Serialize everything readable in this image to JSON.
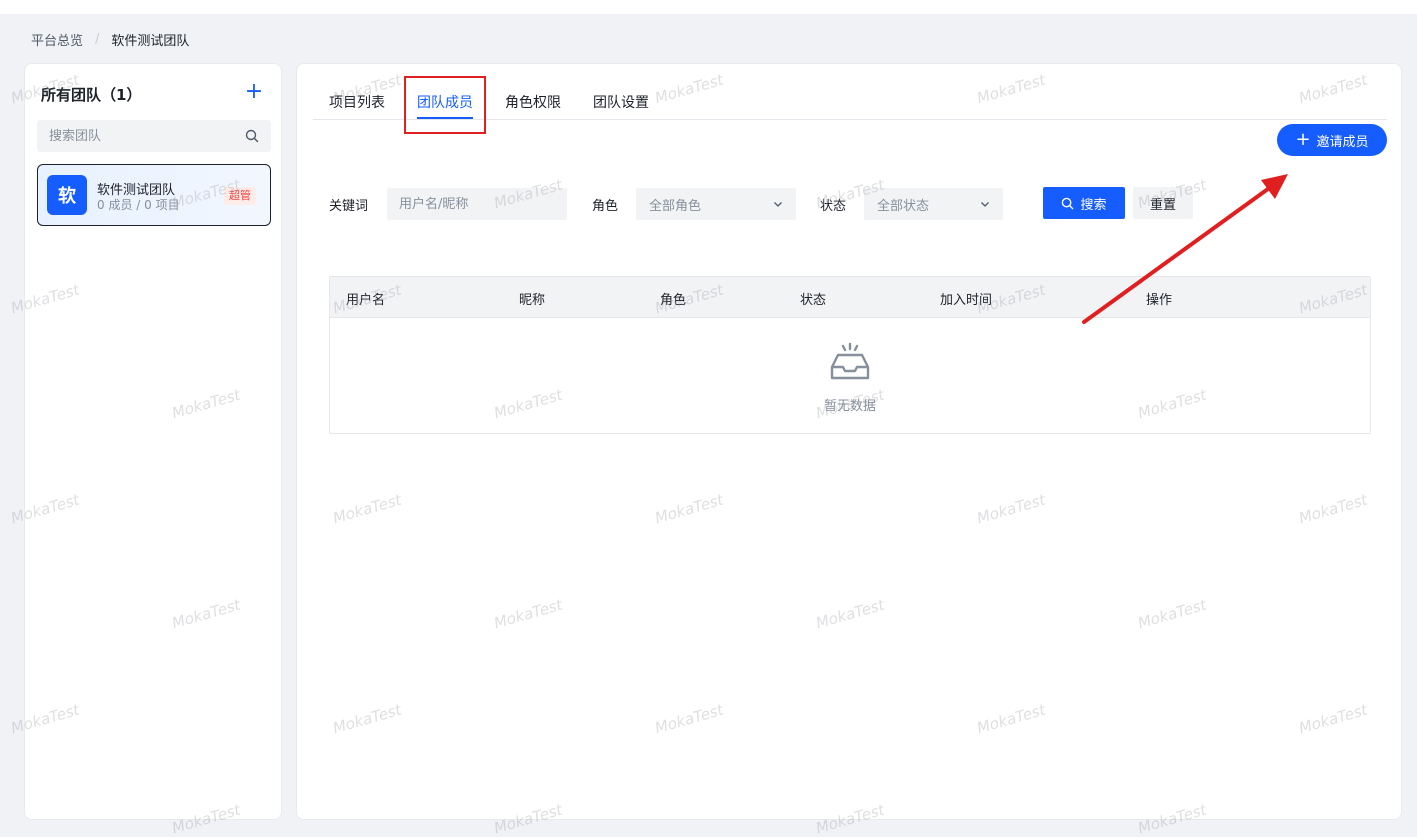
{
  "breadcrumb": {
    "home": "平台总览",
    "separator": "/",
    "current": "软件测试团队"
  },
  "sidebar": {
    "title": "所有团队（1）",
    "search_placeholder": "搜索团队",
    "teams": [
      {
        "avatar": "软",
        "name": "软件测试团队",
        "meta": "0 成员 / 0 项目",
        "badge": "超管"
      }
    ]
  },
  "tabs": [
    {
      "label": "项目列表",
      "active": false
    },
    {
      "label": "团队成员",
      "active": true
    },
    {
      "label": "角色权限",
      "active": false
    },
    {
      "label": "团队设置",
      "active": false
    }
  ],
  "invite_label": "邀请成员",
  "filters": {
    "keyword_label": "关键词",
    "keyword_placeholder": "用户名/昵称",
    "role_label": "角色",
    "role_value": "全部角色",
    "status_label": "状态",
    "status_value": "全部状态",
    "search_label": "搜索",
    "reset_label": "重置"
  },
  "table": {
    "columns": [
      "用户名",
      "昵称",
      "角色",
      "状态",
      "加入时间",
      "操作"
    ],
    "rows": [],
    "empty_text": "暂无数据"
  },
  "watermark_text": "MokaTest",
  "colors": {
    "primary": "#165dff",
    "highlight": "#e02020",
    "badge_text": "#f53f3f"
  }
}
